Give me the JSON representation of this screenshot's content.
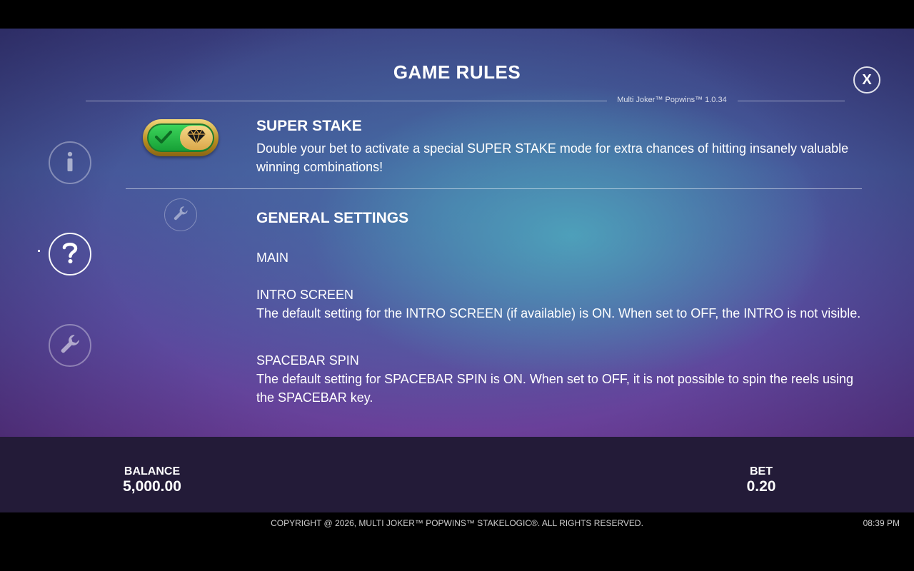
{
  "header": {
    "title": "GAME RULES",
    "close_label": "X",
    "version": "Multi Joker™ Popwins™ 1.0.34"
  },
  "sidebar": {
    "items": [
      {
        "name": "info",
        "icon": "info-icon",
        "active": false
      },
      {
        "name": "help",
        "icon": "question-icon",
        "active": true
      },
      {
        "name": "settings",
        "icon": "wrench-icon",
        "active": false
      }
    ]
  },
  "super_stake": {
    "heading": "SUPER STAKE",
    "text": "Double your bet to activate a special SUPER STAKE mode for extra chances of hitting insanely valuable winning combinations!",
    "toggle_icon": "diamond-icon",
    "toggle_on": true
  },
  "general_settings": {
    "heading": "GENERAL SETTINGS",
    "icon": "wrench-icon",
    "main_label": "MAIN",
    "intro_label": "INTRO SCREEN",
    "intro_text": "The default setting for the INTRO SCREEN (if available) is ON. When set to OFF, the INTRO is not visible.",
    "spacebar_label": "SPACEBAR SPIN",
    "spacebar_text": "The default setting for SPACEBAR SPIN is ON. When set to OFF, it is not possible to spin the reels using the SPACEBAR key."
  },
  "footer": {
    "balance_label": "BALANCE",
    "balance_value": "5,000.00",
    "bet_label": "BET",
    "bet_value": "0.20",
    "copyright": "COPYRIGHT @ 2026, MULTI JOKER™ POPWINS™ STAKELOGIC®. ALL RIGHTS RESERVED.",
    "clock": "08:39 PM"
  },
  "colors": {
    "toggle_green": "#17a137",
    "toggle_gold": "#dba84a",
    "footer_bg": "#231b38"
  }
}
